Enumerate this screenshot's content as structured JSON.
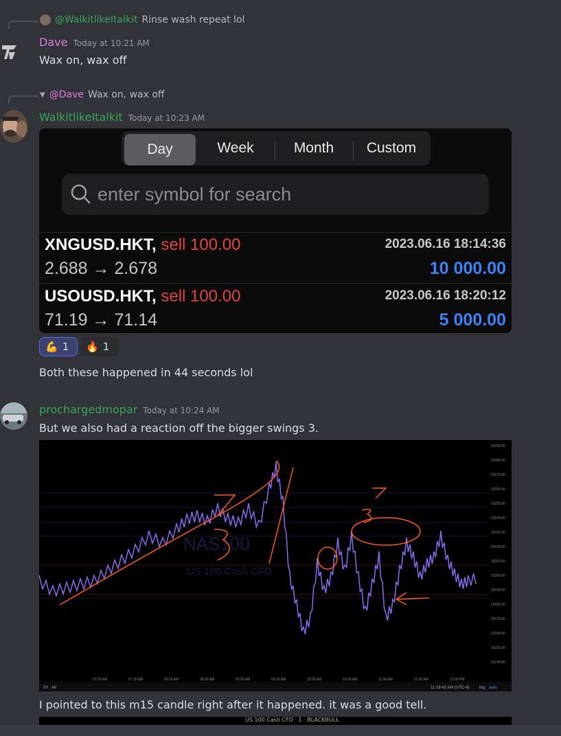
{
  "messages": [
    {
      "reply": {
        "mention": "@WalkitlikeItalkit",
        "text": "Rinse wash repeat lol"
      },
      "author": "Dave",
      "timestamp": "Today at 10:21 AM",
      "content": "Wax on, wax off"
    },
    {
      "reply": {
        "mention": "@Dave",
        "text": "Wax on, wax off"
      },
      "author": "WalkitlikeItalkit",
      "timestamp": "Today at 10:23 AM",
      "content": "Both these happened in 44 seconds lol",
      "reactions": [
        {
          "emoji": "💪",
          "count": "1"
        },
        {
          "emoji": "🔥",
          "count": "1"
        }
      ]
    },
    {
      "author": "prochargedmopar",
      "timestamp": "Today at 10:24 AM",
      "content": "But we also had a reaction off the bigger swings 3.",
      "followup": "I pointed to this m15 candle right after it happened. it was a good tell."
    }
  ],
  "trade_card": {
    "tabs": [
      "Day",
      "Week",
      "Month",
      "Custom"
    ],
    "active_tab": "Day",
    "search_placeholder": "enter symbol for search",
    "trades": [
      {
        "symbol": "XNGUSD.HKT,",
        "side": "sell 100.00",
        "datetime": "2023.06.16 18:14:36",
        "prices": "2.688 → 2.678",
        "amount": "10 000.00"
      },
      {
        "symbol": "USOUSD.HKT,",
        "side": "sell 100.00",
        "datetime": "2023.06.16 18:20:12",
        "prices": "71.19 → 71.14",
        "amount": "5 000.00"
      }
    ]
  },
  "chart_image": {
    "watermark_symbol": "NAS100",
    "watermark_name": "US 100 Cash CFD",
    "time_labels": [
      "07:00 AM",
      "07:30 AM",
      "08:00 AM",
      "08:30 AM",
      "09:00 AM",
      "09:30 AM",
      "10:00 AM",
      "10:30 AM",
      "11:00 AM",
      "11:30 AM",
      "12:00 PM"
    ],
    "price_labels": [
      "15290.00",
      "15280.00",
      "15270.00",
      "15260.00",
      "15250.00",
      "15240.00",
      "15230.00",
      "15220.00",
      "15210.00",
      "15200.00",
      "15190.00",
      "15180.00",
      "15170.00",
      "15160.00",
      "15150.00",
      "15140.00"
    ],
    "footer_time": "11:19:42 AM (UTC-4)",
    "footer_scale": "log",
    "footer_auto": "auto",
    "footer_range": "5Y",
    "footer_all": "All"
  },
  "chart_image_2": {
    "title": "US 100 Cash CFD · 1 · BLACKBULL"
  },
  "colors": {
    "background": "#313338",
    "dave": "#e07be0",
    "green_user": "#3ba55d",
    "sell": "#e0463c",
    "amount": "#3b82f6"
  }
}
